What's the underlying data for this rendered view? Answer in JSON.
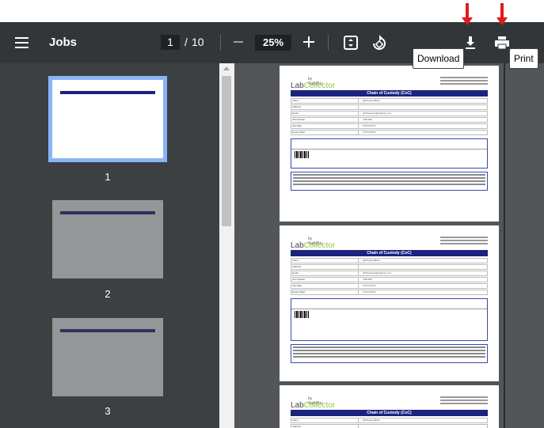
{
  "toolbar": {
    "title": "Jobs",
    "current_page": "1",
    "page_separator": "/",
    "total_pages": "10",
    "zoom": "25%",
    "zoom_out_icon": "minus-icon",
    "zoom_in_icon": "plus-icon",
    "fit_icon": "fit-to-page-icon",
    "rotate_icon": "rotate-icon",
    "download_icon": "download-icon",
    "print_icon": "print-icon",
    "background": "#323639"
  },
  "tooltips": {
    "download": "Download",
    "print": "Print"
  },
  "thumbnails": [
    {
      "label": "1",
      "selected": true
    },
    {
      "label": "2",
      "selected": false
    },
    {
      "label": "3",
      "selected": false
    }
  ],
  "document": {
    "logo_in": "by AgileBio",
    "logo_text_a": "Lab",
    "logo_text_b": "Collector",
    "heading": "Chain of Custody (CoC)",
    "fields": [
      "Client",
      "Address",
      "Email",
      "Job Number",
      "Job Date",
      "Report Date"
    ],
    "field_values": [
      "@PlasqueJBSH",
      "",
      "@Plasquefn@agilebio.com",
      "JOB-000",
      "XXXX/2XXX",
      "XXXX/2XXX"
    ],
    "accent_color": "#1a237e"
  },
  "annotations": {
    "arrow_color": "#e01b1b"
  }
}
